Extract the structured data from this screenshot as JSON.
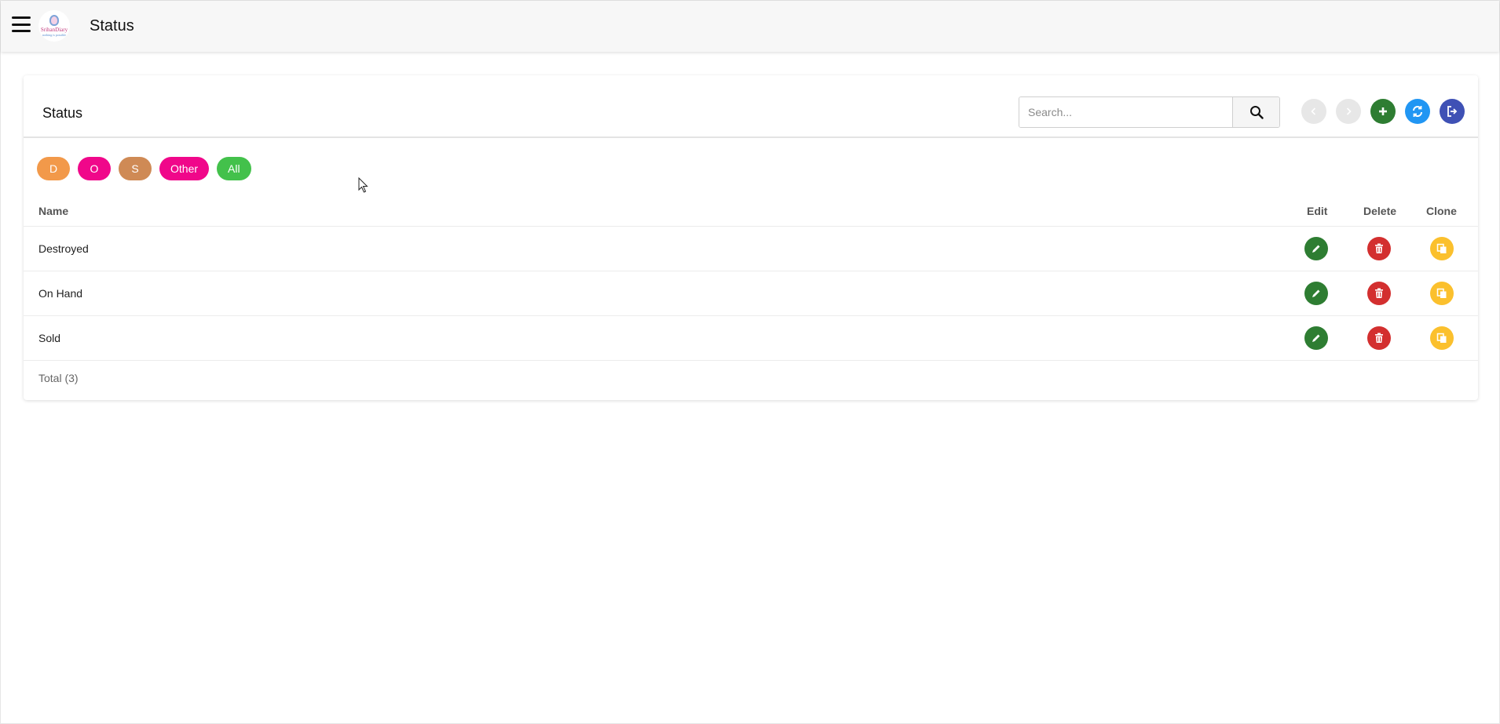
{
  "header": {
    "title": "Status",
    "logo_text": "SrihanDiary",
    "logo_sub": "nothing is possible"
  },
  "card": {
    "title": "Status",
    "search": {
      "placeholder": "Search...",
      "value": ""
    },
    "toolbar": {
      "prev_icon": "chevron-left-icon",
      "next_icon": "chevron-right-icon",
      "add_icon": "plus-icon",
      "refresh_icon": "refresh-icon",
      "exit_icon": "sign-out-icon"
    }
  },
  "filters": [
    {
      "label": "D",
      "color": "#f2994a"
    },
    {
      "label": "O",
      "color": "#f0078a"
    },
    {
      "label": "S",
      "color": "#cf8a55"
    },
    {
      "label": "Other",
      "color": "#f0078a"
    },
    {
      "label": "All",
      "color": "#43c14b"
    }
  ],
  "table": {
    "columns": {
      "name": "Name",
      "edit": "Edit",
      "delete": "Delete",
      "clone": "Clone"
    },
    "rows": [
      {
        "name": "Destroyed"
      },
      {
        "name": "On Hand"
      },
      {
        "name": "Sold"
      }
    ],
    "total": "Total (3)"
  },
  "colors": {
    "edit": "#2e7d32",
    "delete": "#d32f2f",
    "clone": "#fbc02d",
    "add": "#2e7d32",
    "refresh": "#2196f3",
    "exit": "#3f51b5"
  }
}
